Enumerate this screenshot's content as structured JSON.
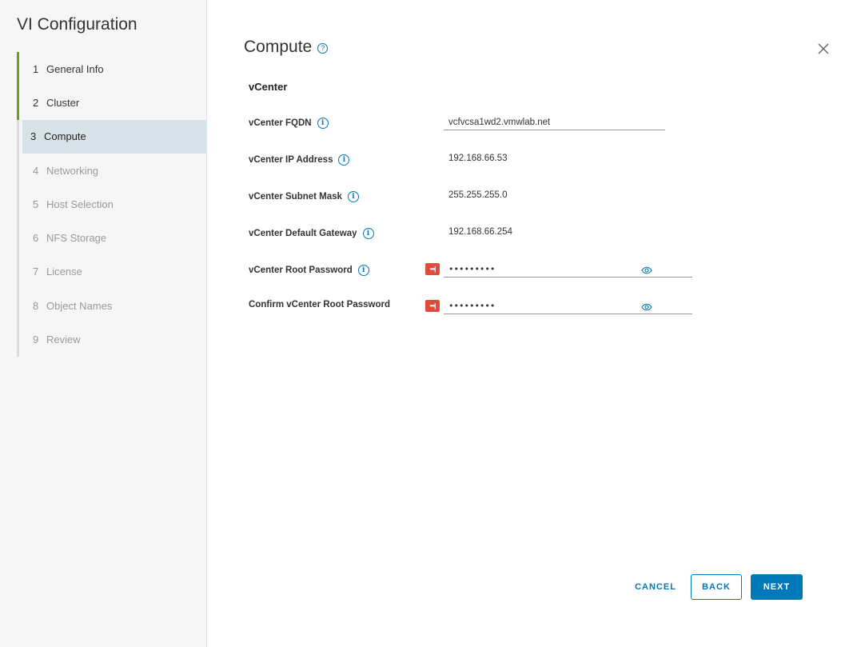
{
  "sidebar": {
    "title": "VI Configuration",
    "steps": [
      {
        "num": "1",
        "label": "General Info"
      },
      {
        "num": "2",
        "label": "Cluster"
      },
      {
        "num": "3",
        "label": "Compute"
      },
      {
        "num": "4",
        "label": "Networking"
      },
      {
        "num": "5",
        "label": "Host Selection"
      },
      {
        "num": "6",
        "label": "NFS Storage"
      },
      {
        "num": "7",
        "label": "License"
      },
      {
        "num": "8",
        "label": "Object Names"
      },
      {
        "num": "9",
        "label": "Review"
      }
    ]
  },
  "main": {
    "title": "Compute",
    "section": "vCenter",
    "fields": {
      "fqdn": {
        "label": "vCenter FQDN",
        "value": "vcfvcsa1wd2.vmwlab.net"
      },
      "ip": {
        "label": "vCenter IP Address",
        "value": "192.168.66.53"
      },
      "subnet": {
        "label": "vCenter Subnet Mask",
        "value": "255.255.255.0"
      },
      "gateway": {
        "label": "vCenter Default Gateway",
        "value": "192.168.66.254"
      },
      "root_password": {
        "label": "vCenter Root Password",
        "value": "•••••••••"
      },
      "confirm_password": {
        "label": "Confirm vCenter Root Password",
        "value": "•••••••••"
      }
    }
  },
  "footer": {
    "cancel": "CANCEL",
    "back": "BACK",
    "next": "NEXT"
  },
  "colors": {
    "accent": "#0079b8",
    "done": "#62a420",
    "active_bg": "#d8e3e9",
    "password_badge": "#e04b3a"
  },
  "icons": {
    "help": "question-circle-icon",
    "info": "info-circle-icon",
    "close": "close-icon",
    "eye": "eye-icon",
    "password_manager": "password-manager-icon"
  }
}
